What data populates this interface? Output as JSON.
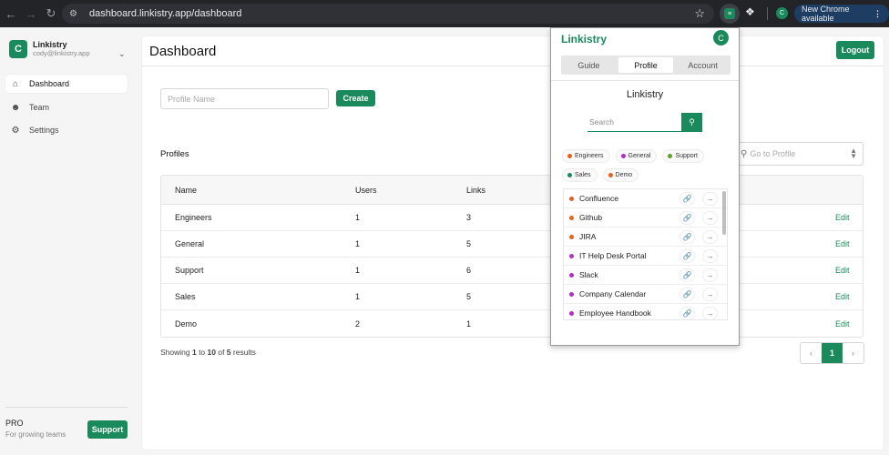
{
  "browser": {
    "url": "dashboard.linkistry.app/dashboard",
    "profile_initial": "C",
    "update_label": "New Chrome available"
  },
  "sidebar": {
    "brand_initial": "C",
    "org_name": "Linkistry",
    "user_email": "cody@linkistry.app",
    "items": [
      {
        "label": "Dashboard",
        "icon": "home-icon",
        "active": true
      },
      {
        "label": "Team",
        "icon": "team-icon",
        "active": false
      },
      {
        "label": "Settings",
        "icon": "gear-icon",
        "active": false
      }
    ],
    "plan_name": "PRO",
    "plan_desc": "For growing teams",
    "support_label": "Support"
  },
  "main": {
    "title": "Dashboard",
    "logout_label": "Logout",
    "profile_name_placeholder": "Profile Name",
    "create_label": "Create",
    "profiles_label": "Profiles",
    "goto_placeholder": "Go to Profile",
    "columns": [
      "Name",
      "Users",
      "Links"
    ],
    "rows": [
      {
        "name": "Engineers",
        "users": "1",
        "links": "3",
        "action": "Edit"
      },
      {
        "name": "General",
        "users": "1",
        "links": "5",
        "action": "Edit"
      },
      {
        "name": "Support",
        "users": "1",
        "links": "6",
        "action": "Edit"
      },
      {
        "name": "Sales",
        "users": "1",
        "links": "5",
        "action": "Edit"
      },
      {
        "name": "Demo",
        "users": "2",
        "links": "1",
        "action": "Edit"
      }
    ],
    "showing_prefix": "Showing ",
    "showing_from": "1",
    "showing_mid1": " to ",
    "showing_to": "10",
    "showing_mid2": " of ",
    "showing_total": "5",
    "showing_suffix": " results",
    "current_page": "1"
  },
  "popup": {
    "title": "Linkistry",
    "avatar_initial": "C",
    "tabs": [
      "Guide",
      "Profile",
      "Account"
    ],
    "active_tab": "Profile",
    "heading": "Linkistry",
    "search_placeholder": "Search",
    "chips": [
      {
        "label": "Engineers",
        "color": "#e8601c"
      },
      {
        "label": "General",
        "color": "#b72cc9"
      },
      {
        "label": "Support",
        "color": "#5ca126"
      },
      {
        "label": "Sales",
        "color": "#1a8a5c"
      },
      {
        "label": "Demo",
        "color": "#e8601c"
      }
    ],
    "links": [
      {
        "label": "Confluence",
        "color": "#e8601c"
      },
      {
        "label": "Github",
        "color": "#e8601c"
      },
      {
        "label": "JIRA",
        "color": "#e8601c"
      },
      {
        "label": "IT Help Desk Portal",
        "color": "#b72cc9"
      },
      {
        "label": "Slack",
        "color": "#b72cc9"
      },
      {
        "label": "Company Calendar",
        "color": "#b72cc9"
      },
      {
        "label": "Employee Handbook",
        "color": "#b72cc9"
      }
    ]
  },
  "colors": {
    "brand": "#1a8a5c"
  }
}
